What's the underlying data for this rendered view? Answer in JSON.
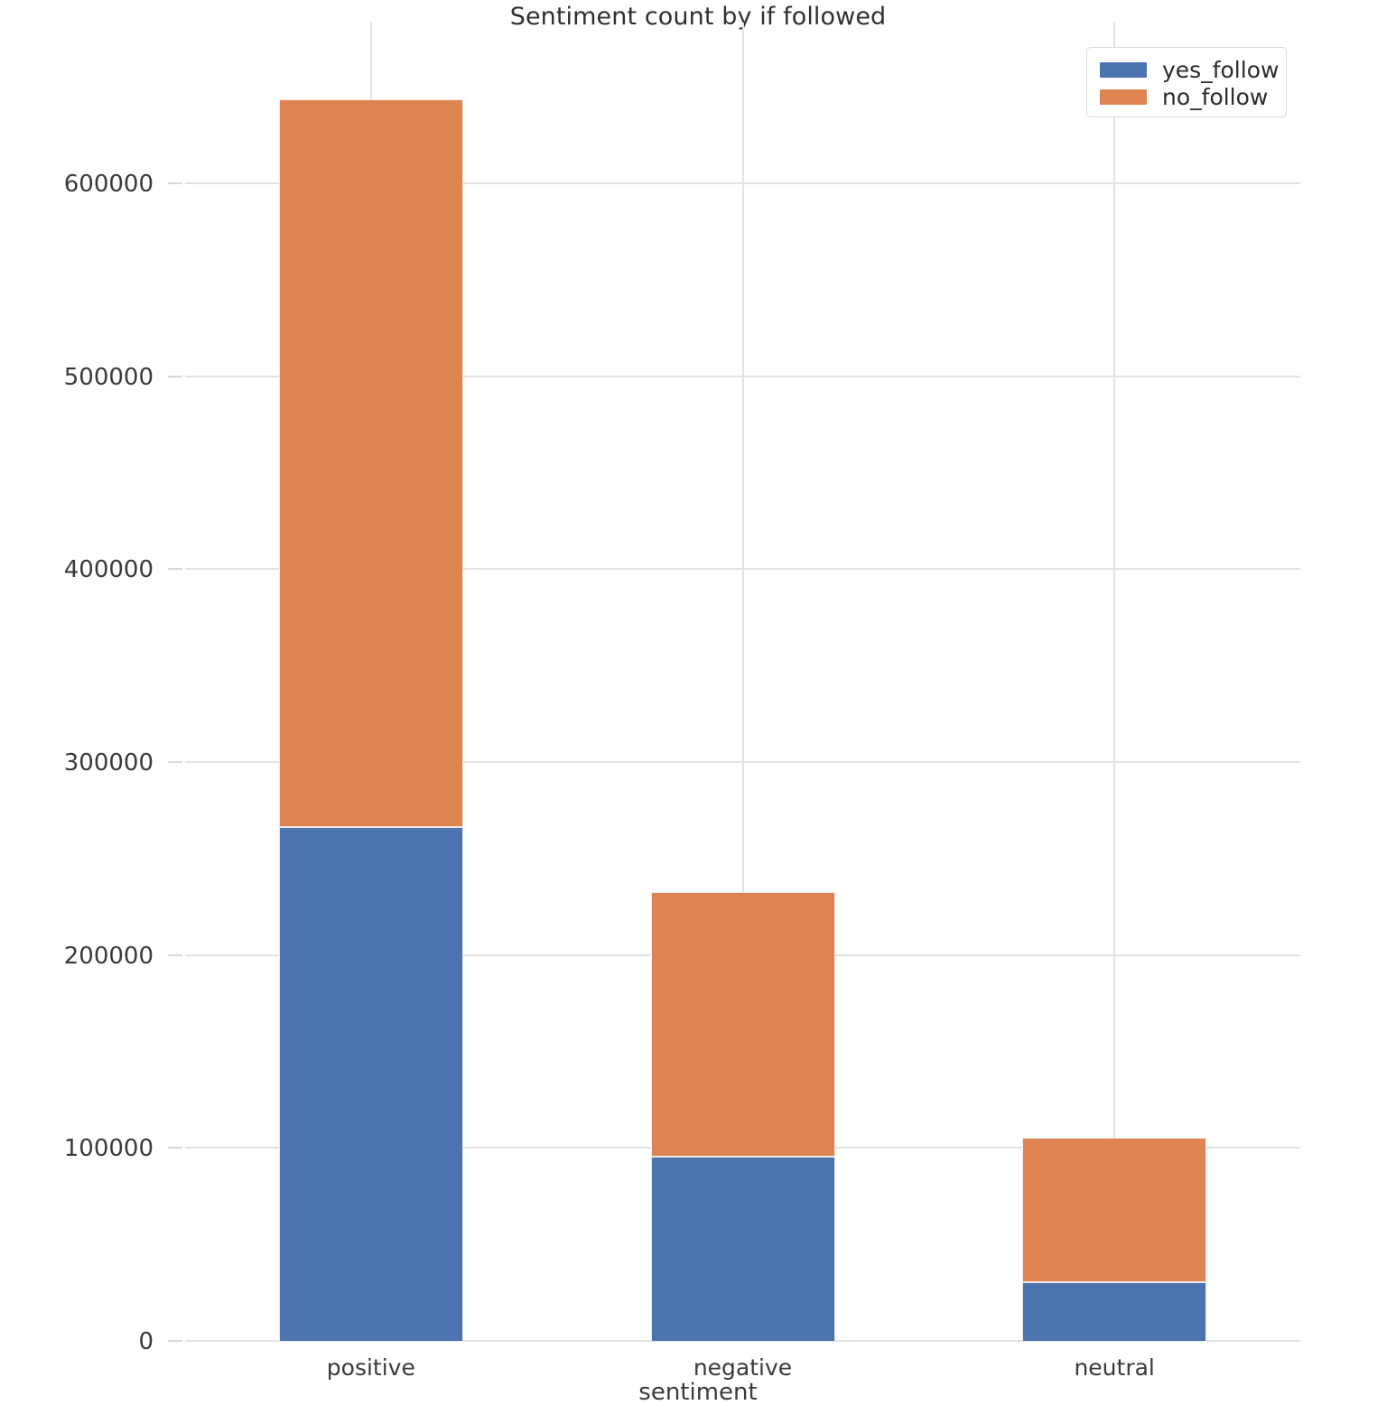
{
  "chart_data": {
    "type": "bar",
    "subtype": "stacked-bar",
    "title": "Sentiment count by if followed",
    "xlabel": "sentiment",
    "ylabel": "",
    "categories": [
      "positive",
      "negative",
      "neutral"
    ],
    "series": [
      {
        "name": "yes_follow",
        "color": "#4c72b0",
        "values": [
          267000,
          96000,
          31000
        ]
      },
      {
        "name": "no_follow",
        "color": "#dd8452",
        "values": [
          377000,
          137000,
          75000
        ]
      }
    ],
    "totals": [
      644000,
      233000,
      106000
    ],
    "ylim": [
      0,
      650000
    ],
    "yticks": [
      0,
      100000,
      200000,
      300000,
      400000,
      500000,
      600000
    ],
    "ytick_labels": [
      "0",
      "100000",
      "200000",
      "300000",
      "400000",
      "500000",
      "600000"
    ],
    "grid": true,
    "grid_axis": "both",
    "legend_position": "top right",
    "legend_entries": [
      "yes_follow",
      "no_follow"
    ],
    "background": "#ffffff",
    "grid_color": "#e2e2e2"
  }
}
